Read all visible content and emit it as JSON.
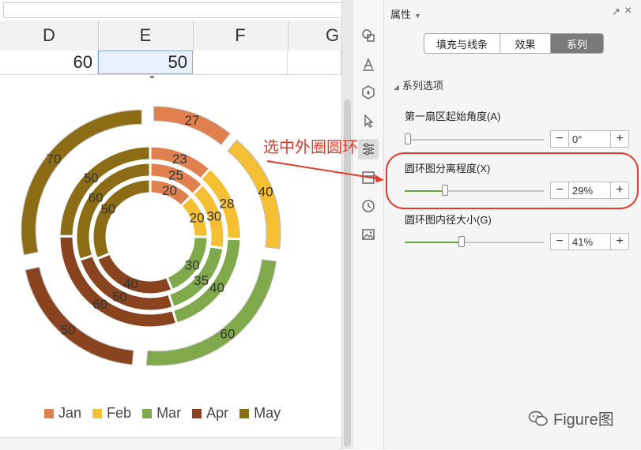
{
  "sheet": {
    "columns": [
      "D",
      "E",
      "F",
      "G"
    ],
    "row_values": [
      "60",
      "50"
    ]
  },
  "panel": {
    "title": "属性",
    "tabs": [
      {
        "label": "填充与线条",
        "active": false
      },
      {
        "label": "效果",
        "active": false
      },
      {
        "label": "系列",
        "active": true
      }
    ],
    "section_title": "系列选项",
    "properties": [
      {
        "label": "第一扇区起始角度(A)",
        "value": "0°",
        "level_percent": 0
      },
      {
        "label": "圆环图分离程度(X)",
        "value": "29%",
        "level_percent": 29
      },
      {
        "label": "圆环图内径大小(G)",
        "value": "41%",
        "level_percent": 41
      }
    ]
  },
  "annotation": {
    "text": "选中外圈圆环",
    "color": "#e43a2c"
  },
  "colors": {
    "Jan": "#e0804e",
    "Feb": "#f5bf34",
    "Mar": "#7fa94a",
    "Apr": "#8a431f",
    "May": "#8c6d16"
  },
  "chart_data": {
    "type": "doughnut",
    "categories": [
      "Jan",
      "Feb",
      "Mar",
      "Apr",
      "May"
    ],
    "series": [
      {
        "values": [
          20,
          20,
          30,
          40,
          50
        ]
      },
      {
        "values": [
          25,
          30,
          35,
          50,
          60
        ]
      },
      {
        "values": [
          23,
          28,
          40,
          60,
          50
        ]
      },
      {
        "values": [
          27,
          40,
          60,
          50,
          70
        ]
      }
    ],
    "legend": "bottom"
  },
  "watermark": "Figure图"
}
